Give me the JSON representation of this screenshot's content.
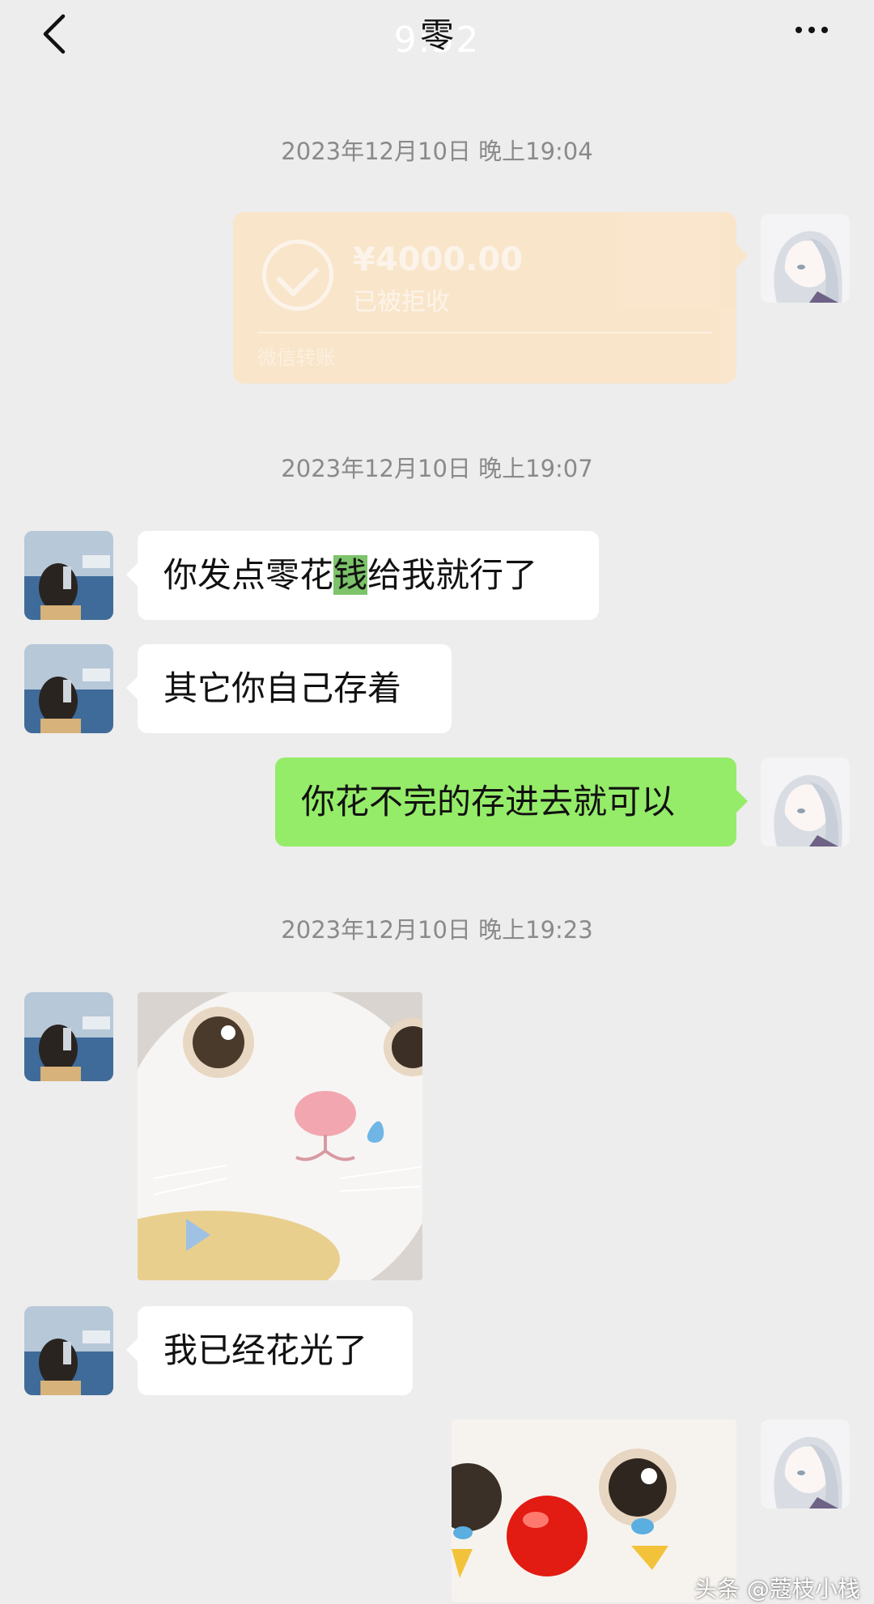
{
  "header": {
    "back_icon": "chevron-left-icon",
    "title": "零",
    "title_ghost": "9:52",
    "more_icon": "more-dots-icon"
  },
  "timestamps": [
    "2023年12月10日 晚上19:04",
    "2023年12月10日 晚上19:07",
    "2023年12月10日 晚上19:23"
  ],
  "transfer": {
    "amount": "¥4000.00",
    "status": "已被拒收",
    "footer": "微信转账",
    "icon": "check-circle-icon",
    "color": "#fce4c5"
  },
  "messages": [
    {
      "side": "in",
      "text_before": "你发点零花",
      "highlight": "钱",
      "text_after": "给我就行了"
    },
    {
      "side": "in",
      "text": "其它你自己存着"
    },
    {
      "side": "out",
      "text": "你花不完的存进去就可以"
    },
    {
      "side": "in",
      "type": "sticker",
      "sticker": "crying-cat-sticker"
    },
    {
      "side": "in",
      "text": "我已经花光了"
    },
    {
      "side": "out",
      "type": "sticker",
      "sticker": "clown-cat-sticker"
    }
  ],
  "colors": {
    "background": "#ededed",
    "bubble_in": "#ffffff",
    "bubble_out": "#95ec69",
    "timestamp": "#8a8a8a"
  },
  "watermark": "头条 @蔻枝小栈"
}
